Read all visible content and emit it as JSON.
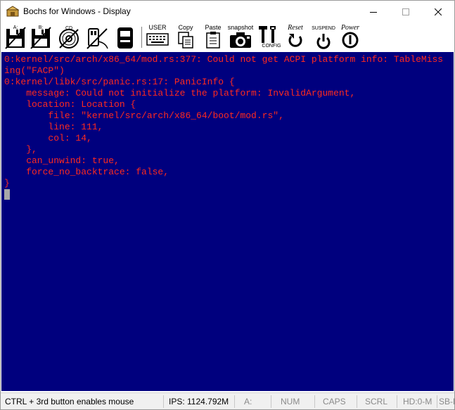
{
  "window": {
    "title": "Bochs for Windows - Display"
  },
  "toolbar": {
    "floppy_a_label": "A:",
    "floppy_b_label": "B:",
    "cdrom_label": "CD",
    "user_label": "USER",
    "copy_label": "Copy",
    "paste_label": "Paste",
    "snapshot_label": "snapshot",
    "config_label": "CONFIG",
    "reset_label": "Reset",
    "suspend_label": "SUSPEND",
    "power_label": "Power"
  },
  "console": {
    "lines": [
      "0:kernel/src/arch/x86_64/mod.rs:377: Could not get ACPI platform info: TableMiss",
      "ing(\"FACP\")",
      "0:kernel/libk/src/panic.rs:17: PanicInfo {",
      "    message: Could not initialize the platform: InvalidArgument,",
      "    location: Location {",
      "        file: \"kernel/src/arch/x86_64/boot/mod.rs\",",
      "        line: 111,",
      "        col: 14,",
      "    },",
      "    can_unwind: true,",
      "    force_no_backtrace: false,",
      "}"
    ]
  },
  "statusbar": {
    "mouse_hint": "CTRL + 3rd button enables mouse",
    "ips": "IPS: 1124.792M",
    "drive": "A:",
    "num": "NUM",
    "caps": "CAPS",
    "scrl": "SCRL",
    "hd": "HD:0-M",
    "extra": "SB-F"
  },
  "colors": {
    "console_bg": "#00007e",
    "console_text": "#ff2a1e",
    "status_bg": "#f0f0f0"
  }
}
